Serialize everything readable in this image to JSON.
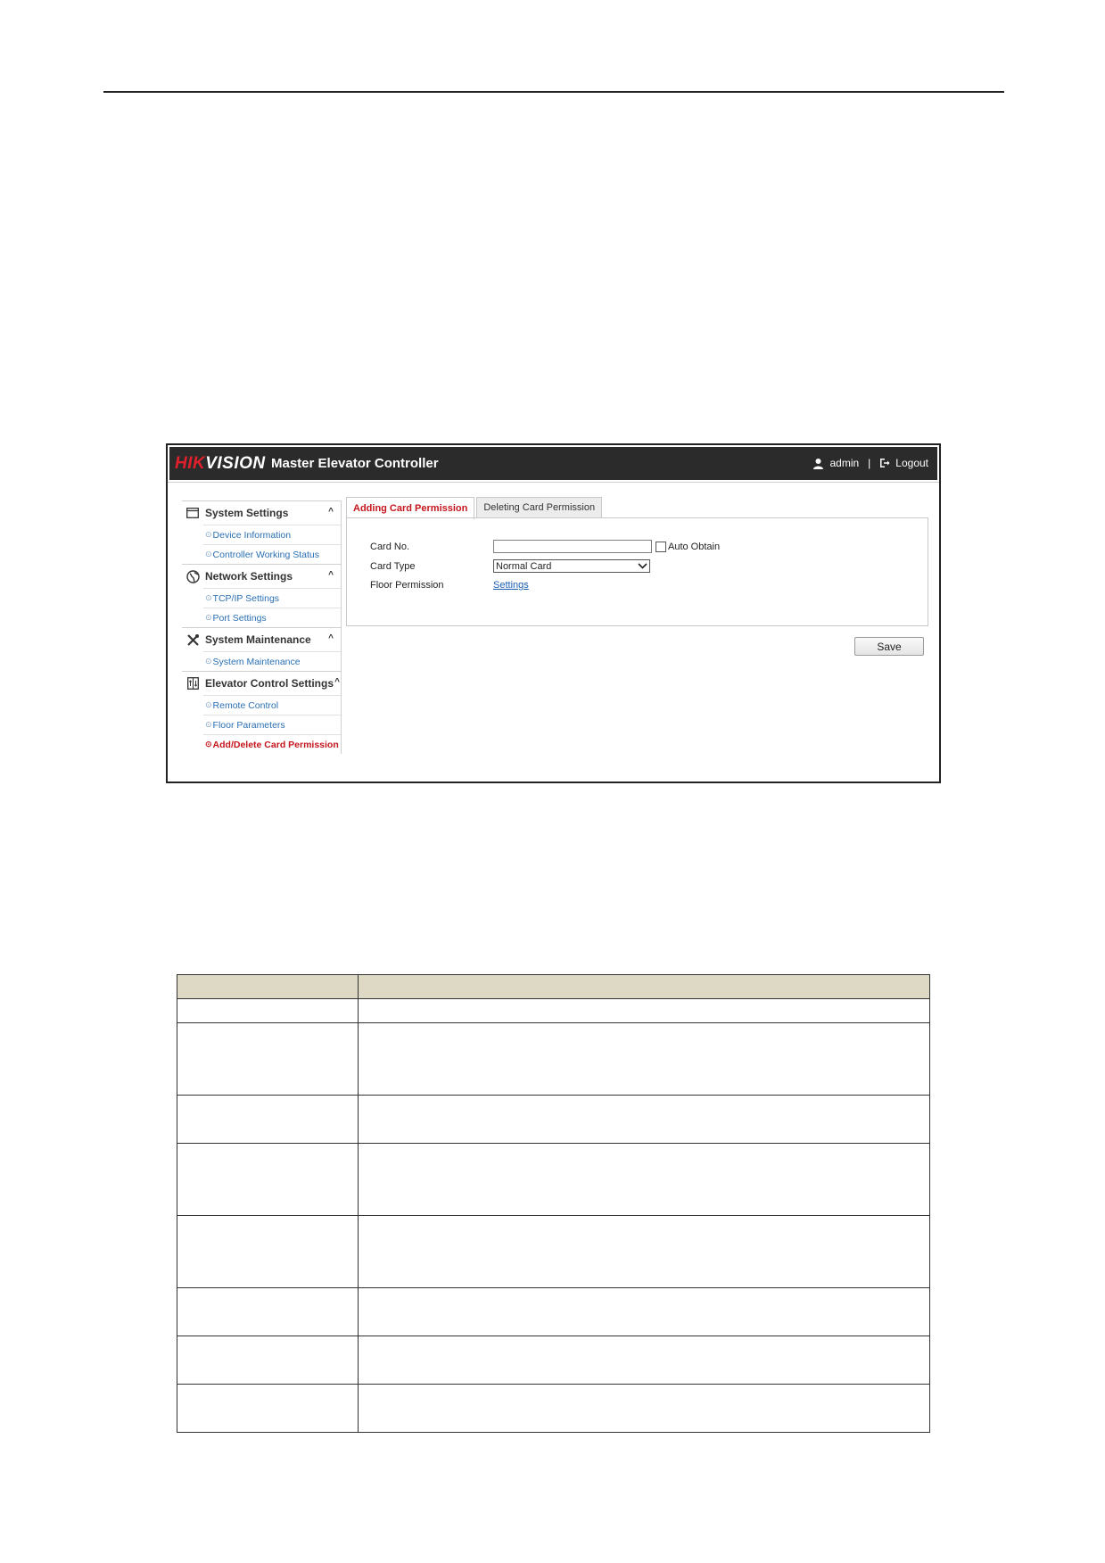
{
  "topbar": {
    "logo_part1": "HIK",
    "logo_part2": "VISION",
    "title": "Master Elevator Controller",
    "user": "admin",
    "separator": "|",
    "logout": "Logout"
  },
  "sidebar": {
    "sections": [
      {
        "label": "System Settings",
        "caret": "^",
        "items": [
          "Device Information",
          "Controller Working Status"
        ]
      },
      {
        "label": "Network Settings",
        "caret": "^",
        "items": [
          "TCP/IP Settings",
          "Port Settings"
        ]
      },
      {
        "label": "System Maintenance",
        "caret": "^",
        "items": [
          "System Maintenance"
        ]
      },
      {
        "label": "Elevator Control Settings",
        "caret": "^",
        "items": [
          "Remote Control",
          "Floor Parameters",
          "Add/Delete Card Permission"
        ]
      }
    ],
    "active_item": "Add/Delete Card Permission"
  },
  "tabs": [
    {
      "label": "Adding Card Permission",
      "active": true
    },
    {
      "label": "Deleting Card Permission",
      "active": false
    }
  ],
  "form": {
    "card_no_label": "Card No.",
    "card_no_value": "",
    "auto_obtain_label": "Auto Obtain",
    "card_type_label": "Card Type",
    "card_type_value": "Normal Card",
    "floor_permission_label": "Floor Permission",
    "floor_permission_link": "Settings"
  },
  "save_label": "Save",
  "colors": {
    "topbar_bg": "#2b2b2b",
    "brand_red": "#e0202a",
    "active_red": "#c4151c",
    "link_blue": "#2a6fb3",
    "table_header_bg": "#ddd9c4"
  }
}
